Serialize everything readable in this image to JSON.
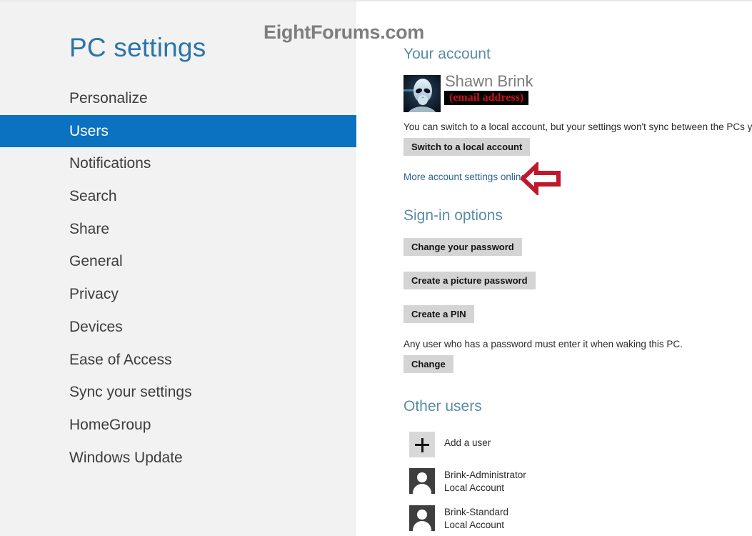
{
  "app": {
    "title": "PC settings",
    "watermark": "EightForums.com"
  },
  "sidebar": {
    "items": [
      {
        "label": "Personalize",
        "selected": false
      },
      {
        "label": "Users",
        "selected": true
      },
      {
        "label": "Notifications",
        "selected": false
      },
      {
        "label": "Search",
        "selected": false
      },
      {
        "label": "Share",
        "selected": false
      },
      {
        "label": "General",
        "selected": false
      },
      {
        "label": "Privacy",
        "selected": false
      },
      {
        "label": "Devices",
        "selected": false
      },
      {
        "label": "Ease of Access",
        "selected": false
      },
      {
        "label": "Sync your settings",
        "selected": false
      },
      {
        "label": "HomeGroup",
        "selected": false
      },
      {
        "label": "Windows Update",
        "selected": false
      }
    ]
  },
  "content": {
    "your_account": {
      "heading": "Your account",
      "user_name": "Shawn Brink",
      "email_badge": "(email address)",
      "avatar_icon": "alien-avatar-icon",
      "switch_description": "You can switch to a local account, but your settings won't sync between the PCs you use.",
      "switch_button": "Switch to a local account",
      "more_settings_link": "More account settings online",
      "annotation_arrow": "left-arrow-annotation-icon"
    },
    "signin_options": {
      "heading": "Sign-in options",
      "change_password_button": "Change your password",
      "picture_password_button": "Create a picture password",
      "create_pin_button": "Create a PIN",
      "wake_description": "Any user who has a password must enter it when waking this PC.",
      "wake_change_button": "Change"
    },
    "other_users": {
      "heading": "Other users",
      "add_user": {
        "label": "Add a user",
        "icon": "plus-icon"
      },
      "users": [
        {
          "name": "Brink-Administrator",
          "type": "Local Account",
          "icon": "person-icon"
        },
        {
          "name": "Brink-Standard",
          "type": "Local Account",
          "icon": "person-icon"
        }
      ]
    }
  },
  "colors": {
    "accent_blue": "#0a72c0",
    "title_blue": "#2a74ab",
    "heading_blue": "#5b8ba8",
    "link_blue": "#2a6496",
    "sidebar_bg": "#f2f2f2",
    "button_bg": "#d4d4d4",
    "annotation_red": "#c0182b",
    "email_red": "#cc1018"
  }
}
